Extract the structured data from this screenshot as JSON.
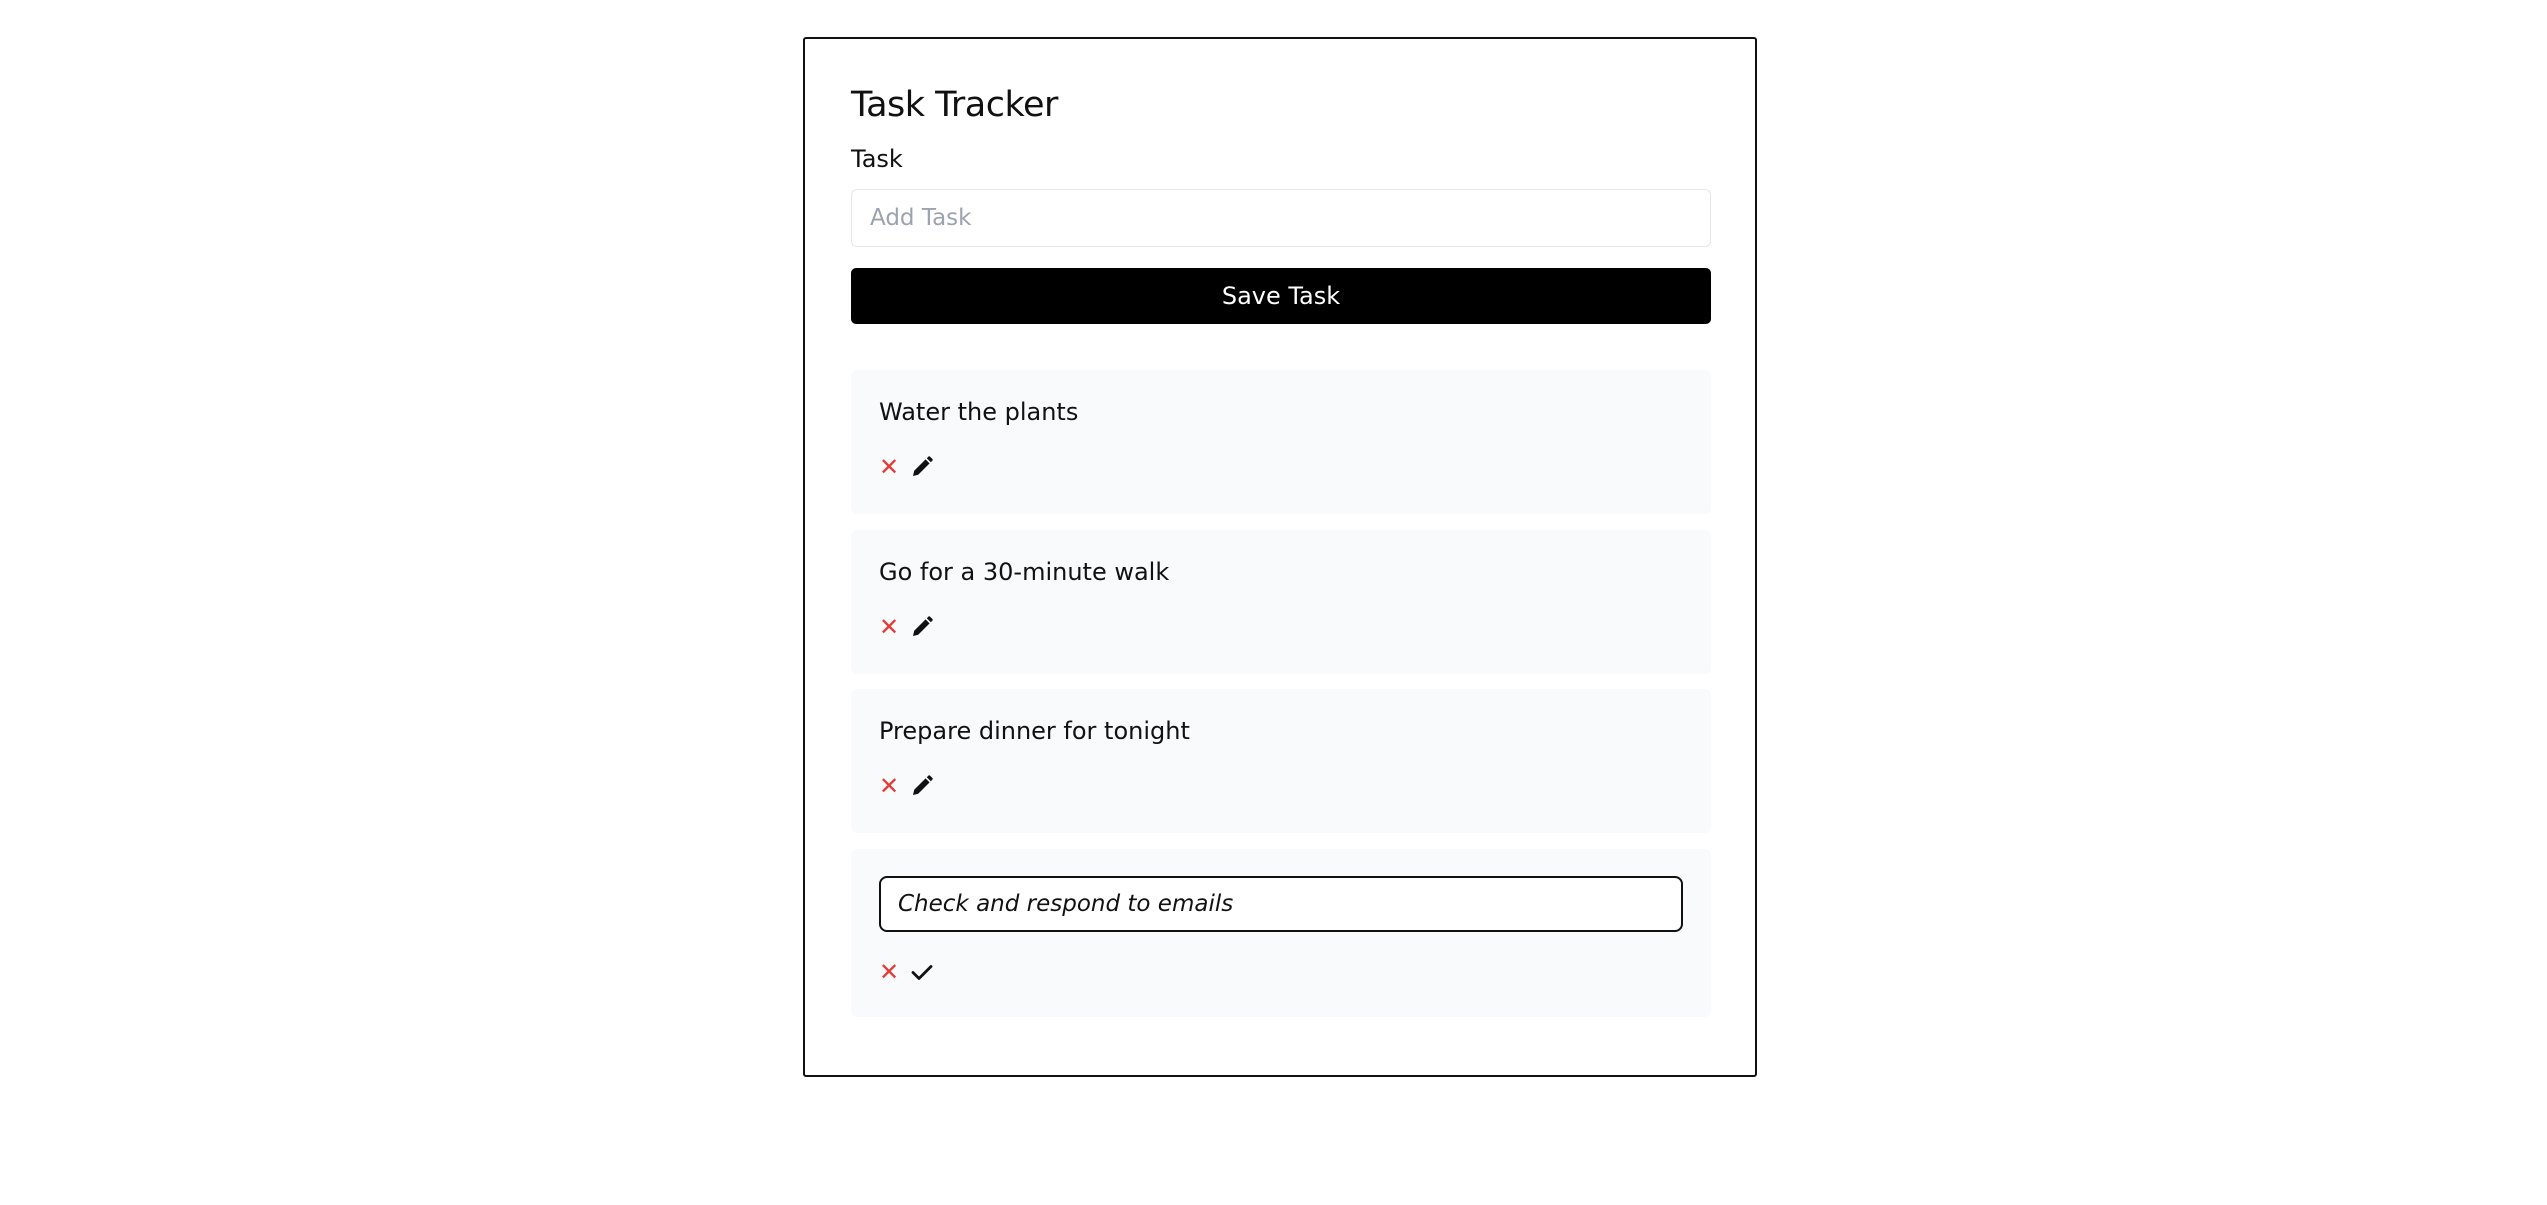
{
  "app": {
    "title": "Task Tracker"
  },
  "form": {
    "label": "Task",
    "placeholder": "Add Task",
    "value": "",
    "save_label": "Save Task"
  },
  "tasks": [
    {
      "text": "Water the plants",
      "editing": false
    },
    {
      "text": "Go for a 30-minute walk",
      "editing": false
    },
    {
      "text": "Prepare dinner for tonight",
      "editing": false
    },
    {
      "text": "Check and respond to emails",
      "editing": true
    }
  ],
  "icons": {
    "delete": "close-icon",
    "edit": "pencil-icon",
    "confirm": "checkmark-icon"
  },
  "colors": {
    "accent": "#000000",
    "delete": "#e53935",
    "task_bg": "#f9fafb"
  }
}
